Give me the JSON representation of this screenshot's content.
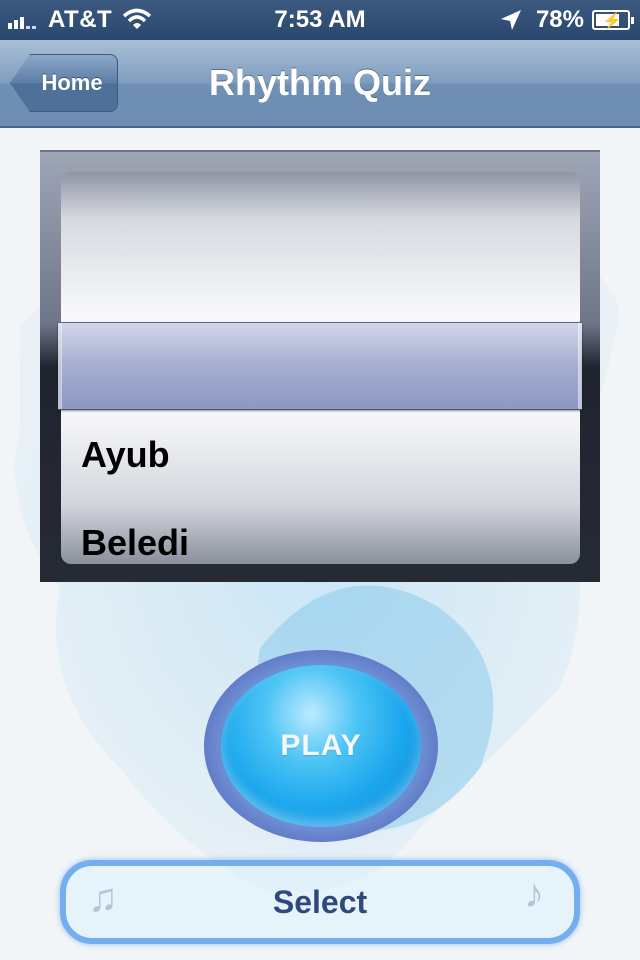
{
  "status_bar": {
    "carrier": "AT&T",
    "time": "7:53 AM",
    "battery_percent": "78%",
    "battery_level": 0.78,
    "signal_icon": "signal-bars-icon",
    "wifi_icon": "wifi-icon",
    "location_icon": "location-arrow-icon",
    "battery_icon": "battery-charging-icon"
  },
  "nav_bar": {
    "back_label": "Home",
    "title": "Rhythm Quiz"
  },
  "picker": {
    "items": [
      "Ayub",
      "Beledi"
    ],
    "selected_label": ""
  },
  "play_button": {
    "label": "PLAY"
  },
  "select_button": {
    "label": "Select"
  },
  "colors": {
    "status_bar": "#2a476d",
    "nav_bar": "#7f9dbf",
    "play_blue": "#1aa6ec",
    "select_border": "#74aef0",
    "select_text": "#2e4a7c"
  }
}
